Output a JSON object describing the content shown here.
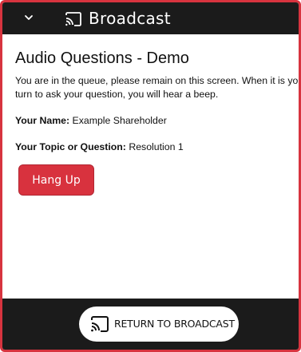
{
  "topbar": {
    "title": "Broadcast",
    "chevron_icon": "chevron-down-icon",
    "cast_icon": "cast-icon"
  },
  "main": {
    "title": "Audio Questions - Demo",
    "notice_line1": "You are in the queue, please remain on this screen. When it is your",
    "notice_line2": "turn to ask your question, you will hear a beep.",
    "name_label": "Your Name:",
    "name_value": "Example Shareholder",
    "topic_label": "Your Topic or Question:",
    "topic_value": "Resolution 1",
    "hang_up_label": "Hang Up"
  },
  "bottombar": {
    "return_label": "RETURN TO BROADCAST",
    "cast_icon": "cast-icon"
  },
  "colors": {
    "accent": "#d8323e",
    "bar": "#1b1b1b",
    "border": "#d7343f"
  }
}
